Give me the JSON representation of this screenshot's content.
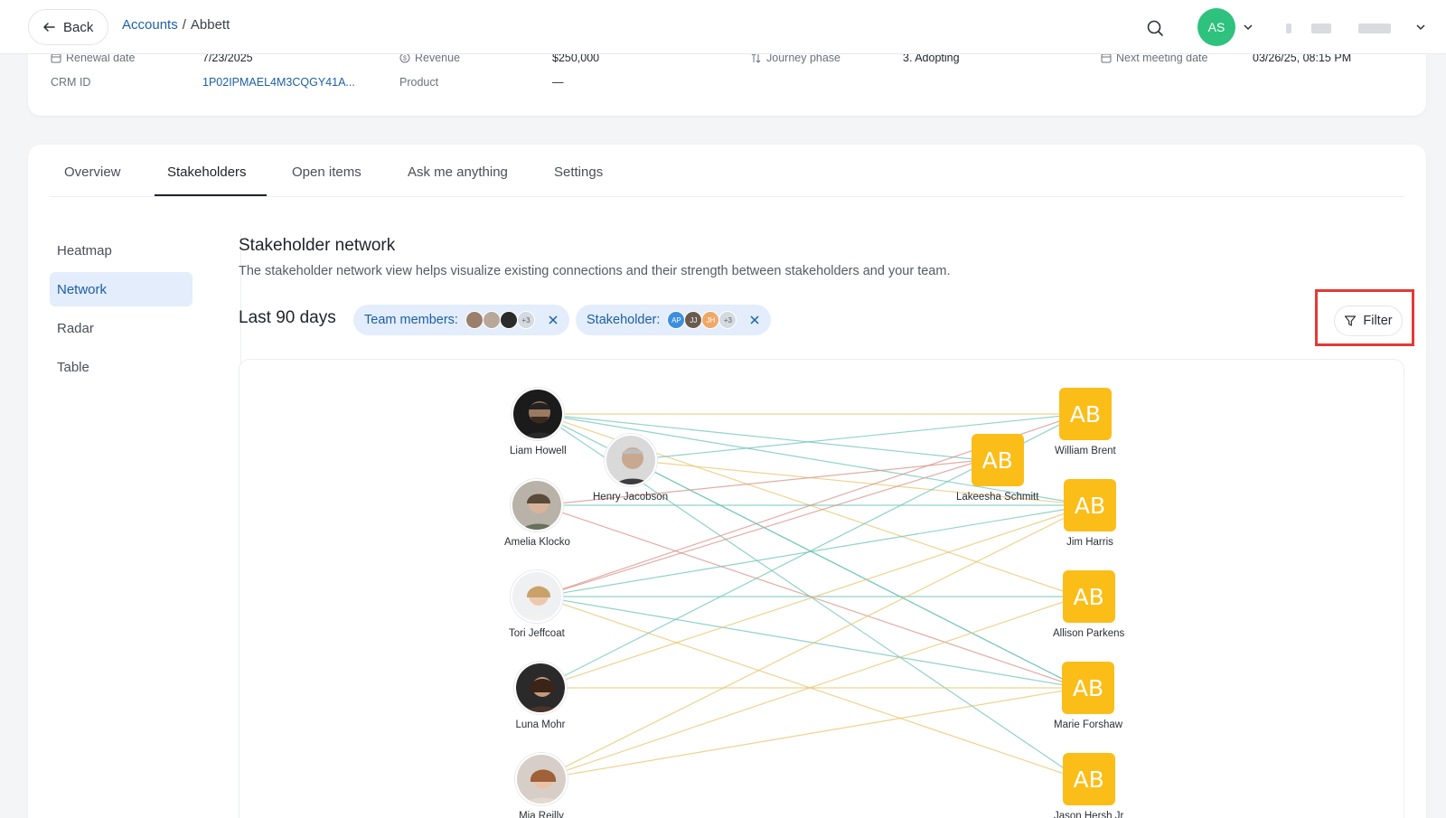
{
  "topbar": {
    "back_label": "Back",
    "breadcrumb": {
      "parent": "Accounts",
      "separator": "/",
      "current": "Abbett"
    },
    "user_initials": "AS"
  },
  "account_info": {
    "renewal_date_label": "Renewal date",
    "renewal_date_value": "7/23/2025",
    "revenue_label": "Revenue",
    "revenue_value": "$250,000",
    "journey_phase_label": "Journey phase",
    "journey_phase_value": "3. Adopting",
    "next_meeting_label": "Next meeting date",
    "next_meeting_value": "03/26/25, 08:15 PM",
    "crm_id_label": "CRM ID",
    "crm_id_value": "1P02IPMAEL4M3CQGY41A...",
    "product_label": "Product",
    "product_value": "—"
  },
  "tabs": {
    "overview": "Overview",
    "stakeholders": "Stakeholders",
    "open_items": "Open items",
    "ask": "Ask me anything",
    "settings": "Settings"
  },
  "side_nav": {
    "heatmap": "Heatmap",
    "network": "Network",
    "radar": "Radar",
    "table": "Table"
  },
  "section": {
    "title": "Stakeholder network",
    "description": "The stakeholder network view helps visualize existing connections and their strength between stakeholders and your team.",
    "period": "Last 90 days"
  },
  "filters": {
    "team_label": "Team members:",
    "team_more": "+3",
    "stakeholder_label": "Stakeholder:",
    "stakeholder_initials": [
      "AP",
      "JJ",
      "JH"
    ],
    "stakeholder_more": "+3",
    "filter_button": "Filter"
  },
  "network": {
    "team_members": [
      {
        "name": "Liam Howell"
      },
      {
        "name": "Henry Jacobson"
      },
      {
        "name": "Amelia Klocko"
      },
      {
        "name": "Tori Jeffcoat"
      },
      {
        "name": "Luna Mohr"
      },
      {
        "name": "Mia Reilly"
      }
    ],
    "stakeholders": [
      {
        "name": "William Brent",
        "initials": "AB"
      },
      {
        "name": "Lakeesha Schmitt",
        "initials": "AB"
      },
      {
        "name": "Jim Harris",
        "initials": "AB"
      },
      {
        "name": "Allison Parkens",
        "initials": "AB"
      },
      {
        "name": "Marie Forshaw",
        "initials": "AB"
      },
      {
        "name": "Jason Hersh Jr",
        "initials": "AB"
      }
    ],
    "colors": {
      "strong": "#e8c46a",
      "medium": "#6cc3b8",
      "weak": "#d99088",
      "tile": "#fbbd18"
    }
  }
}
